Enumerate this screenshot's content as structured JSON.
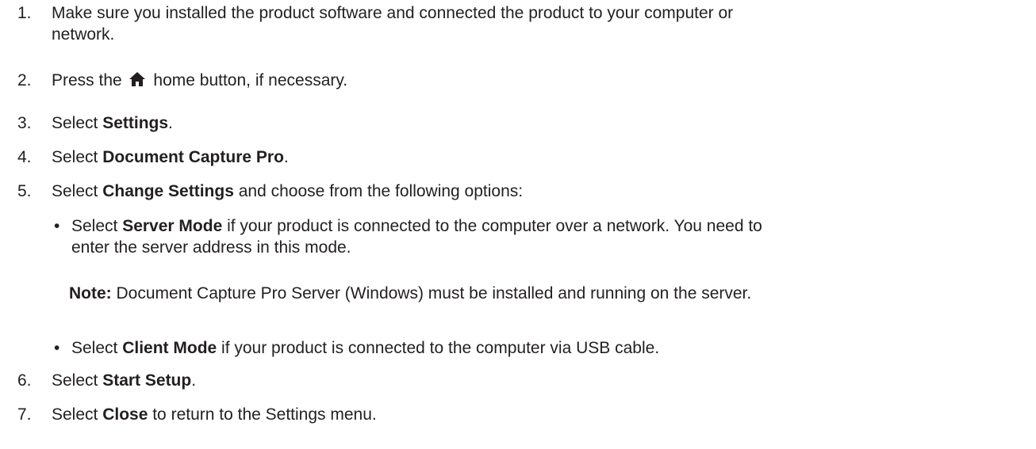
{
  "steps": [
    {
      "number": "1.",
      "line1": "Make sure you installed the product software and connected the product to your computer or",
      "line2": "network."
    },
    {
      "number": "2.",
      "before": "Press the",
      "icon": "home-icon",
      "after": "home button, if necessary."
    },
    {
      "number": "3.",
      "before": "Select ",
      "bold": "Settings",
      "after": "."
    },
    {
      "number": "4.",
      "before": "Select ",
      "bold": "Document Capture Pro",
      "after": "."
    },
    {
      "number": "5.",
      "before": "Select ",
      "bold": "Change Settings",
      "after": " and choose from the following options:",
      "options": [
        {
          "before": "Select ",
          "bold": "Server Mode",
          "line1_after": " if your product is connected to the computer over a network. You need to",
          "line2": "enter the server address in this mode.",
          "note_label": "Note:",
          "note_text": " Document Capture Pro Server (Windows) must be installed and running on the server."
        },
        {
          "before": "Select ",
          "bold": "Client Mode",
          "after": " if your product is connected to the computer via USB cable."
        }
      ]
    },
    {
      "number": "6.",
      "before": "Select ",
      "bold": "Start Setup",
      "after": "."
    },
    {
      "number": "7.",
      "before": "Select ",
      "bold": "Close",
      "after": " to return to the Settings menu."
    }
  ],
  "bullet_char": "•"
}
